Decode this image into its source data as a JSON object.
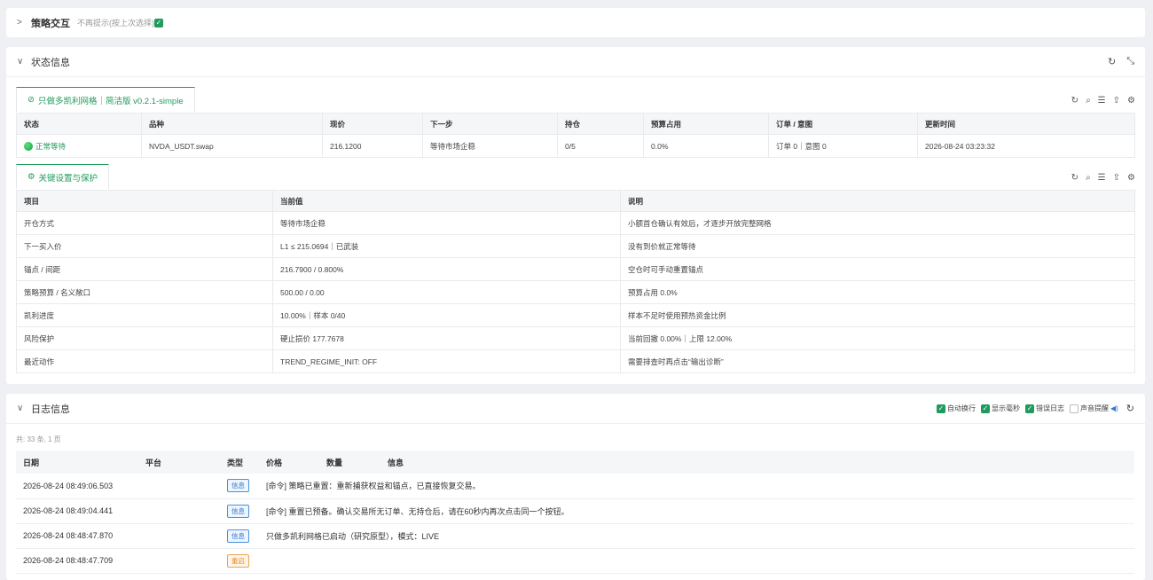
{
  "strategy_panel": {
    "caret": ">",
    "title": "策略交互",
    "hint": "不再提示(按上次选择)"
  },
  "status_panel": {
    "caret": "∨",
    "title": "状态信息",
    "tab1": {
      "label": "只做多凯利网格｜简洁版 v0.2.1-simple",
      "headers": [
        "状态",
        "品种",
        "现价",
        "下一步",
        "持仓",
        "预算占用",
        "订单 / 意图",
        "更新时间"
      ],
      "row": [
        "正常等待",
        "NVDA_USDT.swap",
        "216.1200",
        "等待市场企稳",
        "0/5",
        "0.0%",
        "订单 0｜意图 0",
        "2026-08-24 03:23:32"
      ]
    },
    "tab2": {
      "label": "关键设置与保护",
      "headers": [
        "项目",
        "当前值",
        "说明"
      ],
      "rows": [
        [
          "开仓方式",
          "等待市场企稳",
          "小额首仓确认有效后，才逐步开放完整网格"
        ],
        [
          "下一买入价",
          "L1 ≤ 215.0694｜已武装",
          "没有到价就正常等待"
        ],
        [
          "锚点 / 间距",
          "216.7900 / 0.800%",
          "空仓时可手动重置锚点"
        ],
        [
          "策略预算 / 名义敞口",
          "500.00 / 0.00",
          "预算占用 0.0%"
        ],
        [
          "凯利进度",
          "10.00%｜样本 0/40",
          "样本不足时使用预热资金比例"
        ],
        [
          "风险保护",
          "硬止损价 177.7678",
          "当前回撤 0.00%｜上限 12.00%"
        ],
        [
          "最近动作",
          "TREND_REGIME_INIT: OFF",
          "需要排查时再点击“输出诊断”"
        ]
      ]
    }
  },
  "log_panel": {
    "caret": "∨",
    "title": "日志信息",
    "options": [
      "自动换行",
      "显示毫秒",
      "错误日志",
      "声音提醒"
    ],
    "count": "共: 33 条, 1 页",
    "headers": [
      "日期",
      "平台",
      "类型",
      "价格",
      "数量",
      "信息"
    ],
    "rows": [
      {
        "date": "2026-08-24 08:49:06.503",
        "type": "信息",
        "msg": "[命令] 策略已重置：重新捕获权益和锚点，已直接恢复交易。"
      },
      {
        "date": "2026-08-24 08:49:04.441",
        "type": "信息",
        "msg": "[命令] 重置已预备。确认交易所无订单、无持仓后，请在60秒内再次点击同一个按钮。"
      },
      {
        "date": "2026-08-24 08:48:47.870",
        "type": "信息",
        "msg": "只做多凯利网格已启动（研究原型），模式：LIVE"
      },
      {
        "date": "2026-08-24 08:48:47.709",
        "type": "重启",
        "msg": ""
      }
    ]
  },
  "colors": {
    "accent": "#1f9b5b",
    "info": "#2f78c8",
    "restart": "#e58a1f"
  }
}
